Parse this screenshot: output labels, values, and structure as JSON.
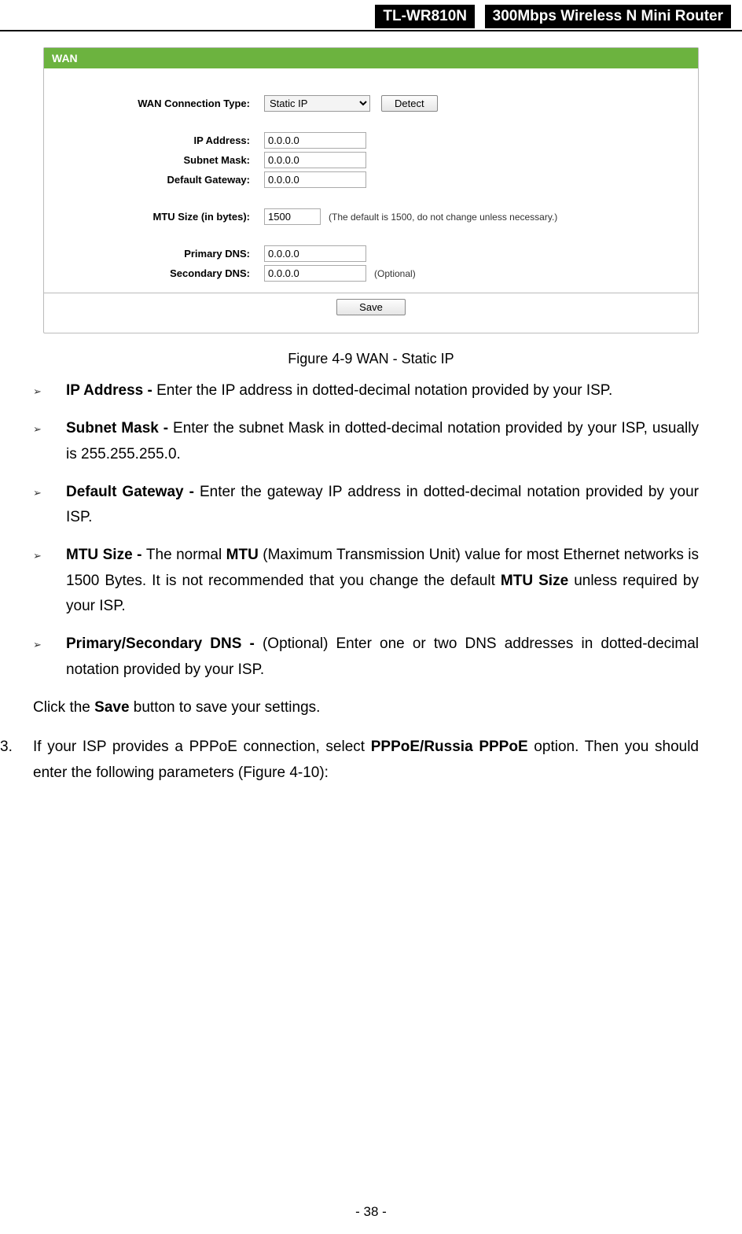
{
  "header": {
    "model": "TL-WR810N",
    "product": "300Mbps Wireless N Mini Router"
  },
  "wan": {
    "title": "WAN",
    "conn_type_label": "WAN Connection Type:",
    "conn_type_value": "Static IP",
    "detect_label": "Detect",
    "ip_label": "IP Address:",
    "ip_value": "0.0.0.0",
    "mask_label": "Subnet Mask:",
    "mask_value": "0.0.0.0",
    "gw_label": "Default Gateway:",
    "gw_value": "0.0.0.0",
    "mtu_label": "MTU Size (in bytes):",
    "mtu_value": "1500",
    "mtu_hint": "(The default is 1500, do not change unless necessary.)",
    "pdns_label": "Primary DNS:",
    "pdns_value": "0.0.0.0",
    "sdns_label": "Secondary DNS:",
    "sdns_value": "0.0.0.0",
    "sdns_hint": "(Optional)",
    "save_label": "Save"
  },
  "figure_caption": "Figure 4-9 WAN - Static IP",
  "bullets": [
    {
      "bold": "IP Address - ",
      "text": "Enter the IP address in dotted-decimal notation provided by your ISP."
    },
    {
      "bold": "Subnet Mask - ",
      "text": "Enter the subnet Mask in dotted-decimal notation provided by your ISP, usually is 255.255.255.0."
    },
    {
      "bold": "Default Gateway - ",
      "text": "Enter the gateway IP address in dotted-decimal notation provided by your ISP."
    }
  ],
  "mtu_bullet": {
    "b1": "MTU Size - ",
    "t1": "The normal ",
    "b2": "MTU",
    "t2": " (Maximum Transmission Unit) value for most Ethernet networks is 1500 Bytes. It is not recommended that you change the default ",
    "b3": "MTU Size",
    "t3": " unless required by your ISP."
  },
  "dns_bullet": {
    "b1": "Primary/Secondary DNS - ",
    "t1": "(Optional) Enter one or two DNS addresses in dotted-decimal notation provided by your ISP."
  },
  "click_save": {
    "t1": "Click the ",
    "b1": "Save",
    "t2": " button to save your settings."
  },
  "item3": {
    "num": "3.",
    "t1": "If your ISP provides a PPPoE connection, select ",
    "b1": "PPPoE/Russia PPPoE",
    "t2": " option. Then you should enter the following parameters (Figure 4-10):"
  },
  "page_number": "- 38 -"
}
